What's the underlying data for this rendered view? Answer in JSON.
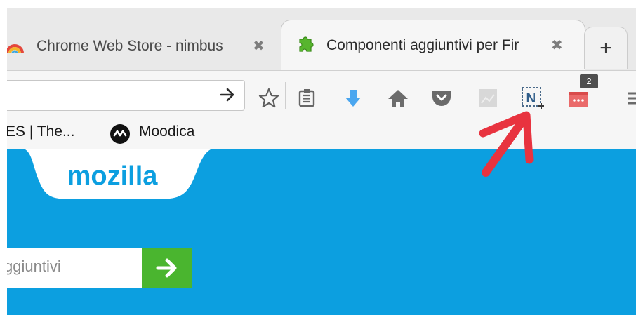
{
  "tabs": [
    {
      "title": "Chrome Web Store - nimbus",
      "active": false
    },
    {
      "title": "Componenti aggiuntivi per Fir",
      "active": true
    }
  ],
  "new_tab_label": "+",
  "toolbar": {
    "icons": [
      "star-icon",
      "reading-list-icon",
      "download-icon",
      "home-icon",
      "pocket-icon",
      "screenshot-icon",
      "nimbus-icon",
      "extension-icon",
      "menu-icon"
    ],
    "badge_count": "2"
  },
  "bookmarks": [
    {
      "label": "ES | The..."
    },
    {
      "label": "Moodica"
    }
  ],
  "page": {
    "logo_text": "mozilla",
    "search_placeholder": "ggiuntivi"
  },
  "colors": {
    "content_bg": "#0c9fe0",
    "search_button": "#4ab52f",
    "annotation_arrow": "#e8333f"
  }
}
